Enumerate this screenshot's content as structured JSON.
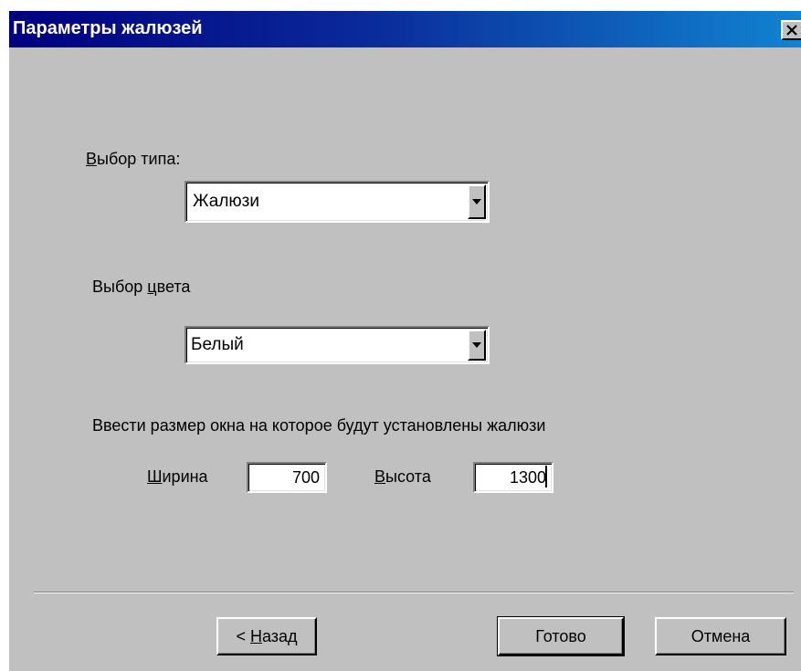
{
  "window": {
    "title": "Параметры жалюзей",
    "close_icon": "close-icon"
  },
  "type_section": {
    "label_mnemonic": "В",
    "label_rest": "ыбор типа:",
    "selected_value": "Жалюзи",
    "dropdown_icon": "chevron-down-icon"
  },
  "color_section": {
    "label_before": "Выбор ",
    "label_mnemonic": "ц",
    "label_after": "вета",
    "selected_value": "Белый",
    "dropdown_icon": "chevron-down-icon"
  },
  "size_section": {
    "instruction": "Ввести размер окна на которое будут установлены жалюзи",
    "width_label_mnemonic": "Ш",
    "width_label_rest": "ирина",
    "width_value": "700",
    "height_label_mnemonic": "В",
    "height_label_rest": "ысота",
    "height_value": "1300"
  },
  "buttons": {
    "back_prefix": "< ",
    "back_mnemonic": "Н",
    "back_rest": "азад",
    "finish_label": "Готово",
    "cancel_label": "Отмена"
  },
  "colors": {
    "title_bar_start": "#000080",
    "title_bar_end": "#1084d0",
    "dialog_face": "#c0c0c0"
  }
}
